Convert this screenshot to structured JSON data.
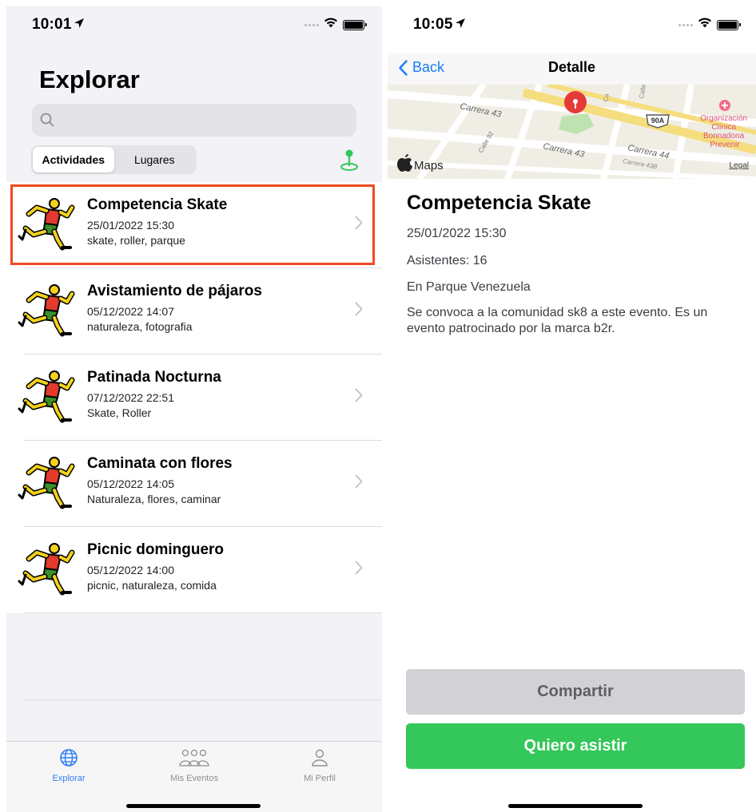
{
  "left": {
    "status_time": "10:01",
    "title": "Explorar",
    "search": {
      "placeholder": ""
    },
    "segments": [
      "Actividades",
      "Lugares"
    ],
    "activities": [
      {
        "name": "Competencia Skate",
        "date": "25/01/2022 15:30",
        "tags": "skate, roller, parque"
      },
      {
        "name": "Avistamiento de pájaros",
        "date": "05/12/2022 14:07",
        "tags": "naturaleza, fotografia"
      },
      {
        "name": "Patinada Nocturna",
        "date": "07/12/2022 22:51",
        "tags": "Skate, Roller"
      },
      {
        "name": "Caminata con flores",
        "date": "05/12/2022 14:05",
        "tags": "Naturaleza, flores, caminar"
      },
      {
        "name": "Picnic dominguero",
        "date": "05/12/2022 14:00",
        "tags": "picnic, naturaleza, comida"
      }
    ],
    "tabs": [
      {
        "label": "Explorar",
        "icon": "globe-icon"
      },
      {
        "label": "Mis Eventos",
        "icon": "people-icon"
      },
      {
        "label": "Mi Perfil",
        "icon": "person-icon"
      }
    ]
  },
  "right": {
    "status_time": "10:05",
    "nav": {
      "back": "Back",
      "title": "Detalle"
    },
    "map": {
      "labels": [
        "Carrera 43",
        "Calle 92",
        "Carrera 43",
        "Carrera 44",
        "Carrera 43B",
        "Calle",
        "Ca"
      ],
      "highway": "90A",
      "poi": "Organización Clínica Bonnadona Prevenir",
      "poi_lines": [
        "Organización",
        "Clínica",
        "Bonnadona",
        "Prevenir"
      ],
      "brand": "Maps",
      "legal": "Legal"
    },
    "event": {
      "title": "Competencia Skate",
      "date": "25/01/2022 15:30",
      "attendees": "Asistentes: 16",
      "location": "En Parque Venezuela",
      "description": "Se convoca a la comunidad sk8 a este evento. Es un evento patrocinado por la marca b2r."
    },
    "buttons": {
      "share": "Compartir",
      "attend": "Quiero asistir"
    }
  },
  "colors": {
    "accent": "#1a7cf5",
    "highlight": "#ef4b22",
    "attend": "#34c759",
    "share": "#d1d1d6",
    "pin": "#e53a3a",
    "location_pin": "#34c759"
  }
}
